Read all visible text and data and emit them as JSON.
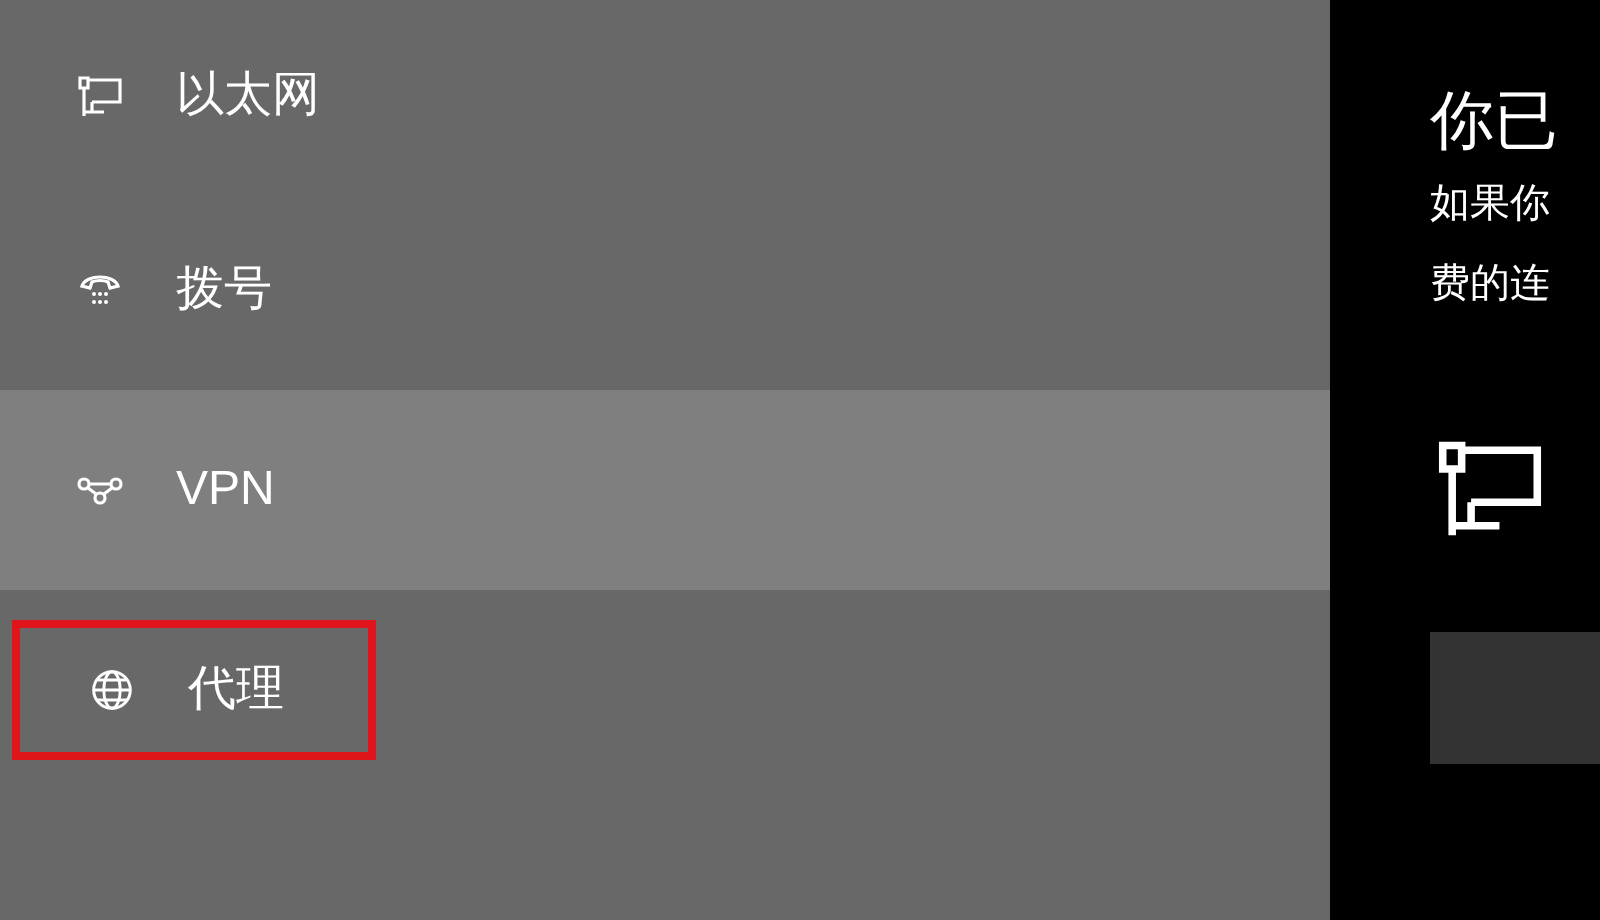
{
  "sidebar": {
    "items": [
      {
        "kind": "ethernet",
        "label": "以太网",
        "selected": false,
        "outlined": false
      },
      {
        "kind": "dialup",
        "label": "拨号",
        "selected": false,
        "outlined": false
      },
      {
        "kind": "vpn",
        "label": "VPN",
        "selected": true,
        "outlined": false
      },
      {
        "kind": "proxy",
        "label": "代理",
        "selected": false,
        "outlined": true
      }
    ]
  },
  "content": {
    "title": "你已",
    "description_lines": [
      "如果你",
      "费的连"
    ],
    "device": {
      "kind": "ethernet"
    },
    "button": {
      "kind": "blank"
    }
  }
}
